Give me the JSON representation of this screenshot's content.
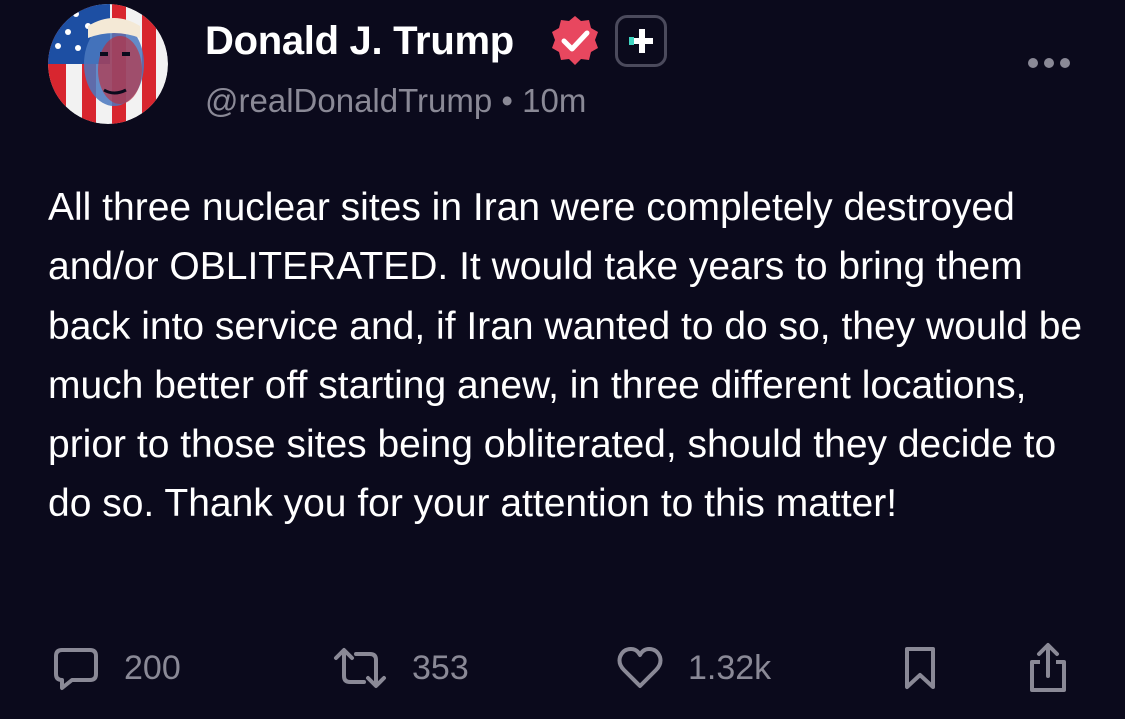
{
  "post": {
    "author": {
      "display_name": "Donald J. Trump",
      "handle": "@realDonaldTrump",
      "separator": "•",
      "time": "10m",
      "avatar": "flag-painted-portrait",
      "verified_badge": "verified-check-icon",
      "verified_color": "#e8475f"
    },
    "more_icon": "more-horizontal-icon",
    "text": "All three nuclear sites in Iran were completely destroyed and/or OBLITERATED. It would take years to bring them back into service and, if Iran wanted to do so, they would be much better off starting anew, in three different locations, prior to those sites being obliterated, should they decide to do so. Thank you for your attention to this matter!",
    "actions": {
      "replies": {
        "icon": "comment-icon",
        "count": "200"
      },
      "retruths": {
        "icon": "retruth-icon",
        "count": "353"
      },
      "likes": {
        "icon": "heart-icon",
        "count": "1.32k"
      },
      "bookmark": {
        "icon": "bookmark-icon"
      },
      "share": {
        "icon": "share-icon"
      }
    }
  },
  "colors": {
    "background": "#0b0a1c",
    "text": "#ffffff",
    "secondary_text": "#8a8996",
    "accent_teal": "#3fd6c2"
  }
}
